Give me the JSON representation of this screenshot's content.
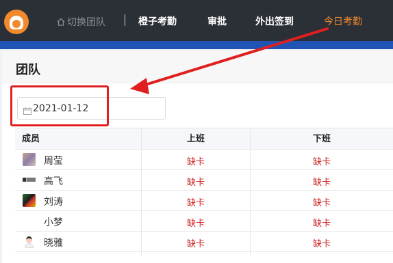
{
  "header": {
    "switch_team": "切换团队",
    "nav": [
      "橙子考勤",
      "审批",
      "外出签到",
      "今日考勤"
    ],
    "active_index": 3
  },
  "panel": {
    "title": "团队",
    "date_value": "2021-01-12"
  },
  "table": {
    "columns": [
      "成员",
      "上班",
      "下班"
    ],
    "rows": [
      {
        "name": "周莹",
        "on_duty": "缺卡",
        "off_duty": "缺卡"
      },
      {
        "name": "高飞",
        "on_duty": "缺卡",
        "off_duty": "缺卡"
      },
      {
        "name": "刘涛",
        "on_duty": "缺卡",
        "off_duty": "缺卡"
      },
      {
        "name": "小梦",
        "on_duty": "缺卡",
        "off_duty": "缺卡"
      },
      {
        "name": "晓雅",
        "on_duty": "缺卡",
        "off_duty": "缺卡"
      }
    ]
  },
  "colors": {
    "topbar": "#2b2f36",
    "active_nav": "#f08a2c",
    "missing_status": "#cc1f1f",
    "annotation": "#e02020"
  }
}
